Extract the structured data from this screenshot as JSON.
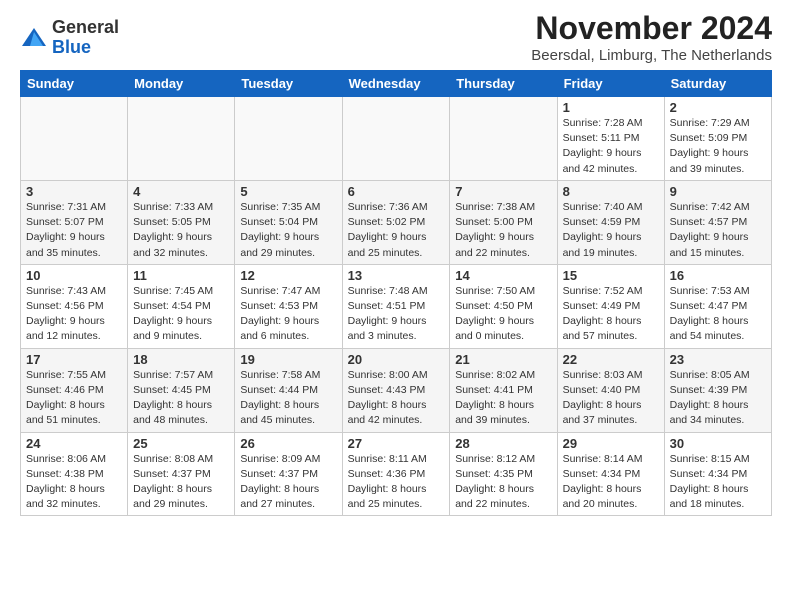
{
  "header": {
    "logo_general": "General",
    "logo_blue": "Blue",
    "month_title": "November 2024",
    "location": "Beersdal, Limburg, The Netherlands"
  },
  "weekdays": [
    "Sunday",
    "Monday",
    "Tuesday",
    "Wednesday",
    "Thursday",
    "Friday",
    "Saturday"
  ],
  "weeks": [
    [
      {
        "day": "",
        "info": ""
      },
      {
        "day": "",
        "info": ""
      },
      {
        "day": "",
        "info": ""
      },
      {
        "day": "",
        "info": ""
      },
      {
        "day": "",
        "info": ""
      },
      {
        "day": "1",
        "info": "Sunrise: 7:28 AM\nSunset: 5:11 PM\nDaylight: 9 hours and 42 minutes."
      },
      {
        "day": "2",
        "info": "Sunrise: 7:29 AM\nSunset: 5:09 PM\nDaylight: 9 hours and 39 minutes."
      }
    ],
    [
      {
        "day": "3",
        "info": "Sunrise: 7:31 AM\nSunset: 5:07 PM\nDaylight: 9 hours and 35 minutes."
      },
      {
        "day": "4",
        "info": "Sunrise: 7:33 AM\nSunset: 5:05 PM\nDaylight: 9 hours and 32 minutes."
      },
      {
        "day": "5",
        "info": "Sunrise: 7:35 AM\nSunset: 5:04 PM\nDaylight: 9 hours and 29 minutes."
      },
      {
        "day": "6",
        "info": "Sunrise: 7:36 AM\nSunset: 5:02 PM\nDaylight: 9 hours and 25 minutes."
      },
      {
        "day": "7",
        "info": "Sunrise: 7:38 AM\nSunset: 5:00 PM\nDaylight: 9 hours and 22 minutes."
      },
      {
        "day": "8",
        "info": "Sunrise: 7:40 AM\nSunset: 4:59 PM\nDaylight: 9 hours and 19 minutes."
      },
      {
        "day": "9",
        "info": "Sunrise: 7:42 AM\nSunset: 4:57 PM\nDaylight: 9 hours and 15 minutes."
      }
    ],
    [
      {
        "day": "10",
        "info": "Sunrise: 7:43 AM\nSunset: 4:56 PM\nDaylight: 9 hours and 12 minutes."
      },
      {
        "day": "11",
        "info": "Sunrise: 7:45 AM\nSunset: 4:54 PM\nDaylight: 9 hours and 9 minutes."
      },
      {
        "day": "12",
        "info": "Sunrise: 7:47 AM\nSunset: 4:53 PM\nDaylight: 9 hours and 6 minutes."
      },
      {
        "day": "13",
        "info": "Sunrise: 7:48 AM\nSunset: 4:51 PM\nDaylight: 9 hours and 3 minutes."
      },
      {
        "day": "14",
        "info": "Sunrise: 7:50 AM\nSunset: 4:50 PM\nDaylight: 9 hours and 0 minutes."
      },
      {
        "day": "15",
        "info": "Sunrise: 7:52 AM\nSunset: 4:49 PM\nDaylight: 8 hours and 57 minutes."
      },
      {
        "day": "16",
        "info": "Sunrise: 7:53 AM\nSunset: 4:47 PM\nDaylight: 8 hours and 54 minutes."
      }
    ],
    [
      {
        "day": "17",
        "info": "Sunrise: 7:55 AM\nSunset: 4:46 PM\nDaylight: 8 hours and 51 minutes."
      },
      {
        "day": "18",
        "info": "Sunrise: 7:57 AM\nSunset: 4:45 PM\nDaylight: 8 hours and 48 minutes."
      },
      {
        "day": "19",
        "info": "Sunrise: 7:58 AM\nSunset: 4:44 PM\nDaylight: 8 hours and 45 minutes."
      },
      {
        "day": "20",
        "info": "Sunrise: 8:00 AM\nSunset: 4:43 PM\nDaylight: 8 hours and 42 minutes."
      },
      {
        "day": "21",
        "info": "Sunrise: 8:02 AM\nSunset: 4:41 PM\nDaylight: 8 hours and 39 minutes."
      },
      {
        "day": "22",
        "info": "Sunrise: 8:03 AM\nSunset: 4:40 PM\nDaylight: 8 hours and 37 minutes."
      },
      {
        "day": "23",
        "info": "Sunrise: 8:05 AM\nSunset: 4:39 PM\nDaylight: 8 hours and 34 minutes."
      }
    ],
    [
      {
        "day": "24",
        "info": "Sunrise: 8:06 AM\nSunset: 4:38 PM\nDaylight: 8 hours and 32 minutes."
      },
      {
        "day": "25",
        "info": "Sunrise: 8:08 AM\nSunset: 4:37 PM\nDaylight: 8 hours and 29 minutes."
      },
      {
        "day": "26",
        "info": "Sunrise: 8:09 AM\nSunset: 4:37 PM\nDaylight: 8 hours and 27 minutes."
      },
      {
        "day": "27",
        "info": "Sunrise: 8:11 AM\nSunset: 4:36 PM\nDaylight: 8 hours and 25 minutes."
      },
      {
        "day": "28",
        "info": "Sunrise: 8:12 AM\nSunset: 4:35 PM\nDaylight: 8 hours and 22 minutes."
      },
      {
        "day": "29",
        "info": "Sunrise: 8:14 AM\nSunset: 4:34 PM\nDaylight: 8 hours and 20 minutes."
      },
      {
        "day": "30",
        "info": "Sunrise: 8:15 AM\nSunset: 4:34 PM\nDaylight: 8 hours and 18 minutes."
      }
    ]
  ]
}
